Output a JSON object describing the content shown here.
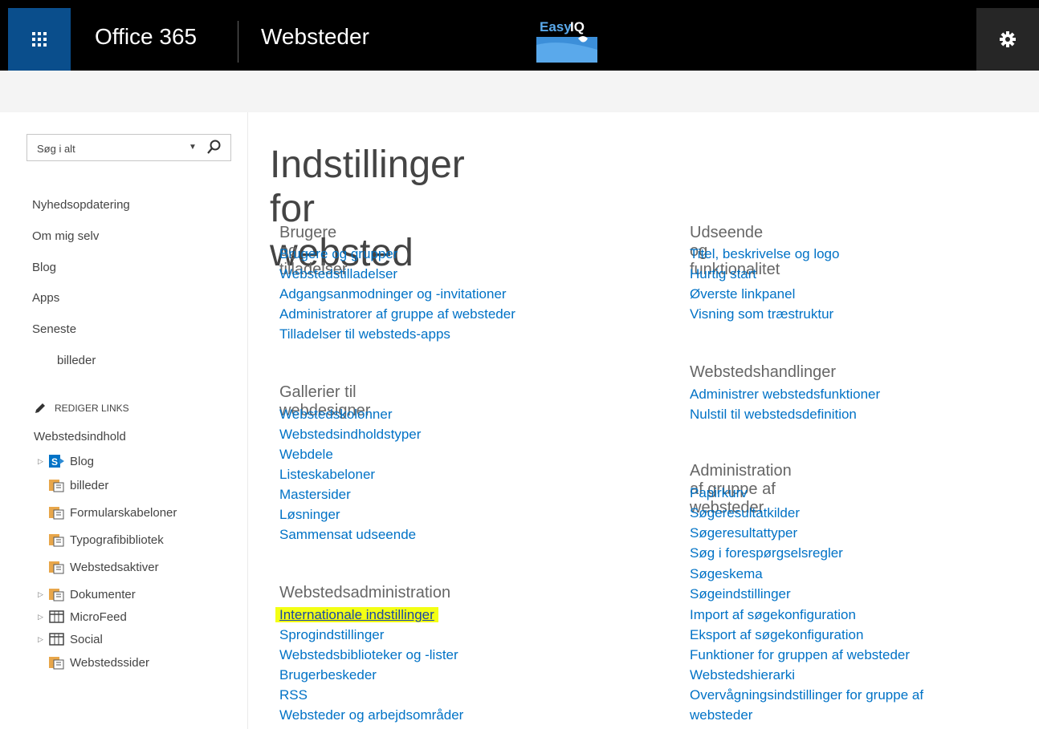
{
  "header": {
    "app_name": "Office 365",
    "site_title": "Websteder",
    "logo_text": "EasyIQ"
  },
  "sidebar": {
    "search": {
      "placeholder": "Søg i alt"
    },
    "nav_items": [
      "Nyhedsopdatering",
      "Om mig selv",
      "Blog",
      "Apps",
      "Seneste"
    ],
    "recent_sub": "billeder",
    "edit_links": "REDIGER LINKS",
    "content_label": "Webstedsindhold",
    "tree": [
      {
        "label": "Blog",
        "icon": "sharepoint-site-icon",
        "expandable": true
      },
      {
        "label": "billeder",
        "icon": "library-icon",
        "expandable": false
      },
      {
        "label": "Formularskabeloner",
        "icon": "library-icon",
        "expandable": false
      },
      {
        "label": "Typografibibliotek",
        "icon": "library-icon",
        "expandable": false
      },
      {
        "label": "Webstedsaktiver",
        "icon": "library-icon",
        "expandable": false
      },
      {
        "label": "Dokumenter",
        "icon": "library-icon",
        "expandable": true
      },
      {
        "label": "MicroFeed",
        "icon": "list-icon",
        "expandable": true
      },
      {
        "label": "Social",
        "icon": "list-icon",
        "expandable": true
      },
      {
        "label": "Webstedssider",
        "icon": "library-icon",
        "expandable": false
      }
    ]
  },
  "page_title": "Indstillinger for websted",
  "sections": {
    "users": {
      "heading": "Brugere og tilladelser",
      "links": [
        "Brugere og grupper",
        "Webstedstilladelser",
        "Adgangsanmodninger og -invitationer",
        "Administratorer af gruppe af websteder",
        "Tilladelser til websteds-apps"
      ]
    },
    "galleries": {
      "heading": "Gallerier til webdesigner",
      "links": [
        "Webstedskolonner",
        "Webstedsindholdstyper",
        "Webdele",
        "Listeskabeloner",
        "Mastersider",
        "Løsninger",
        "Sammensat udseende"
      ]
    },
    "site_admin": {
      "heading": "Webstedsadministration",
      "links": [
        "Internationale indstillinger",
        "Sprogindstillinger",
        "Webstedsbiblioteker og -lister",
        "Brugerbeskeder",
        "RSS",
        "Websteder og arbejdsområder"
      ]
    },
    "look": {
      "heading": "Udseende og funktionalitet",
      "links": [
        "Titel, beskrivelse og logo",
        "Hurtig start",
        "Øverste linkpanel",
        "Visning som træstruktur"
      ]
    },
    "actions": {
      "heading": "Webstedshandlinger",
      "links": [
        "Administrer webstedsfunktioner",
        "Nulstil til webstedsdefinition"
      ]
    },
    "collection_admin": {
      "heading": "Administration af gruppe af websteder",
      "links": [
        "Papirkurv",
        "Søgeresultatkilder",
        "Søgeresultattyper",
        "Søg i forespørgselsregler",
        "Søgeskema",
        "Søgeindstillinger",
        "Import af søgekonfiguration",
        "Eksport af søgekonfiguration",
        "Funktioner for gruppen af websteder",
        "Webstedshierarki",
        "Overvågningsindstillinger for gruppe af",
        "websteder"
      ]
    }
  },
  "colors": {
    "link": "#0072c6",
    "highlight": "#f3ff14",
    "waffle_bg": "#0a4e8c"
  }
}
